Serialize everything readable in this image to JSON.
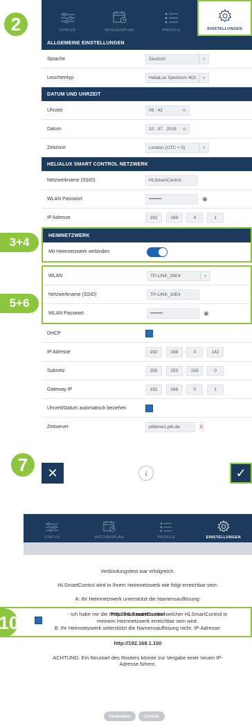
{
  "badges": {
    "b2": "2",
    "b34": "3+4",
    "b56": "5+6",
    "b7": "7",
    "b10": "10"
  },
  "nav": {
    "tabs": [
      {
        "label": "STATUS",
        "icon": "sliders-icon"
      },
      {
        "label": "WOCHENPLAN",
        "icon": "calendar-clock-icon"
      },
      {
        "label": "PROFILE",
        "icon": "list-icon"
      },
      {
        "label": "EINSTELLUNGEN",
        "icon": "gear-icon"
      }
    ]
  },
  "general": {
    "title": "ALLGEMEINE EINSTELLUNGEN",
    "language_label": "Sprache",
    "language_value": "Deutsch",
    "light_label": "Leuchtentyp",
    "light_value": "HeliaLux Spectrum 4Ch"
  },
  "datetime": {
    "title": "DATUM UND UHRZEIT",
    "time_label": "Uhrzeit",
    "time_value": "08 : 42",
    "date_label": "Datum",
    "date_value": "10 . 07 . 2019",
    "tz_label": "Zeitzone",
    "tz_value": "London (UTC + 0)"
  },
  "hl_network": {
    "title": "HELIALUX SMART CONTROL NETZWERK",
    "ssid_label": "Netzwerkname (SSID)",
    "ssid_value": "HLSmartControl",
    "pw_label": "WLAN Passwort",
    "pw_value": "••••••••",
    "ip_label": "IP Adresse",
    "ip": [
      "192",
      "168",
      "4",
      "1"
    ]
  },
  "home_network": {
    "title": "HEIMNETZWERK",
    "connect_label": "Mit Heimnetzwerk verbinden",
    "wlan_label": "WLAN",
    "wlan_value": "TP-LINK_33E4",
    "ssid_label": "Netzwerkname (SSID)",
    "ssid_value": "TP-LINK_33E4",
    "pw_label": "WLAN Passwort",
    "pw_value": "••••••••",
    "dhcp_label": "DHCP",
    "ip_label": "IP Adresse",
    "ip": [
      "192",
      "168",
      "0",
      "142"
    ],
    "subnet_label": "Subnetz",
    "subnet": [
      "255",
      "255",
      "255",
      "0"
    ],
    "gateway_label": "Gateway IP",
    "gateway": [
      "192",
      "168",
      "0",
      "1"
    ],
    "auto_label": "Uhrzeit/Datum automatisch beziehen",
    "server_label": "Zeitserver",
    "server_value": "ptbtime1.ptb.de",
    "server_clear": "X"
  },
  "footer": {
    "cancel": "✕",
    "info": "i",
    "ok": "✓"
  },
  "dialog": {
    "line1": "Verbindungstest war erfolgreich.",
    "line2": "HLSmartControl wird in Ihrem Heimnetzwerk wie folgt erreichbar sein:",
    "line3": "A: Ihr Heimnetzwerk unterstützt die Namensauflösung:",
    "url1": "http://HLSmartControl",
    "line4": "B: Ihr Heimnetzwerk unterstützt die Namensauflösung nicht. IP-Adresse:",
    "url2": "http://192.168.1.100",
    "warn1": "ACHTUNG: Ein Neustart des Routers könnte zur Vergabe einer neuen IP-",
    "warn2": "Adresse führen.",
    "check1": "- Ich habe mir die IP-Adresse notiert unter welcher HLSmartControl in",
    "check2": "meinem Heimnetzwerk erreichbar sein wird.",
    "connect": "Verbinden",
    "back": "Zurück"
  },
  "colors": {
    "navy": "#1c3a5c",
    "green": "#8cc63e",
    "blue": "#2b6cb0"
  }
}
